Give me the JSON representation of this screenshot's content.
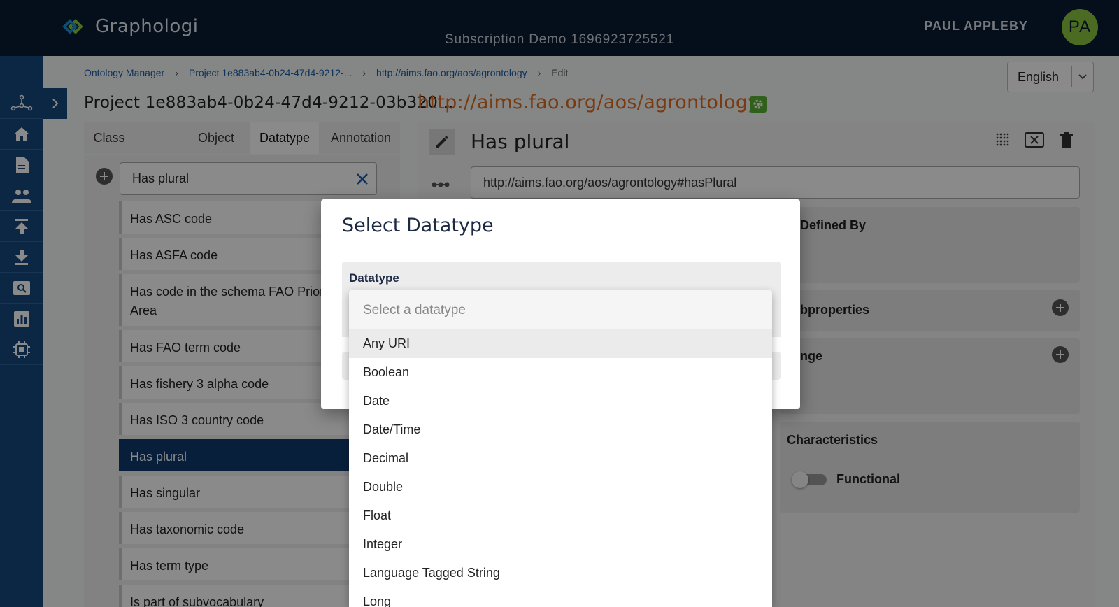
{
  "header": {
    "app_name": "Graphologi",
    "subtitle": "Subscription Demo 1696923725521",
    "user_name": "PAUL APPLEBY",
    "avatar_initials": "PA",
    "avatar_color": "#8dc63f"
  },
  "rail": {
    "icons": [
      "graph-icon",
      "home-icon",
      "document-icon",
      "users-icon",
      "upload-icon",
      "download-icon",
      "search-image-icon",
      "chart-icon",
      "chip-icon"
    ]
  },
  "breadcrumb": {
    "items": [
      "Ontology Manager",
      "Project 1e883ab4-0b24-47d4-9212-...",
      "http://aims.fao.org/aos/agrontology",
      "Edit"
    ]
  },
  "language": {
    "selected": "English"
  },
  "project_title": "Project 1e883ab4-0b24-47d4-9212-03b320...",
  "ontology_url": "http://aims.fao.org/aos/agrontology",
  "tabs": [
    {
      "label": "Class"
    },
    {
      "label": "Object"
    },
    {
      "label": "Datatype"
    },
    {
      "label": "Annotation"
    }
  ],
  "search": {
    "value": "Has plural"
  },
  "list": {
    "items": [
      "Has ASC code",
      "Has ASFA code",
      "Has code in the schema FAO Priority Area",
      "Has FAO term code",
      "Has fishery 3 alpha code",
      "Has ISO 3 country code",
      "Has plural",
      "Has singular",
      "Has taxonomic code",
      "Has term type",
      "Is part of subvocabulary"
    ],
    "selected": "Has plural"
  },
  "detail": {
    "title": "Has plural",
    "iri": "http://aims.fao.org/aos/agrontology#hasPlural",
    "defined_by_label": "Defined By",
    "subproperties_label": "bproperties",
    "range_label": "nge",
    "characteristics_label": "Characteristics",
    "functional_label": "Functional"
  },
  "modal": {
    "title": "Select Datatype",
    "field_label": "Datatype",
    "placeholder": "Select a datatype",
    "options": [
      "Any URI",
      "Boolean",
      "Date",
      "Date/Time",
      "Decimal",
      "Double",
      "Float",
      "Integer",
      "Language Tagged String",
      "Long"
    ],
    "highlighted": "Any URI"
  },
  "colors": {
    "topbar": "#0b1a33",
    "rail": "#16497f",
    "accent_orange": "#e06b1f",
    "selected_item": "#0f3a6e",
    "link": "#1d5ea8"
  }
}
